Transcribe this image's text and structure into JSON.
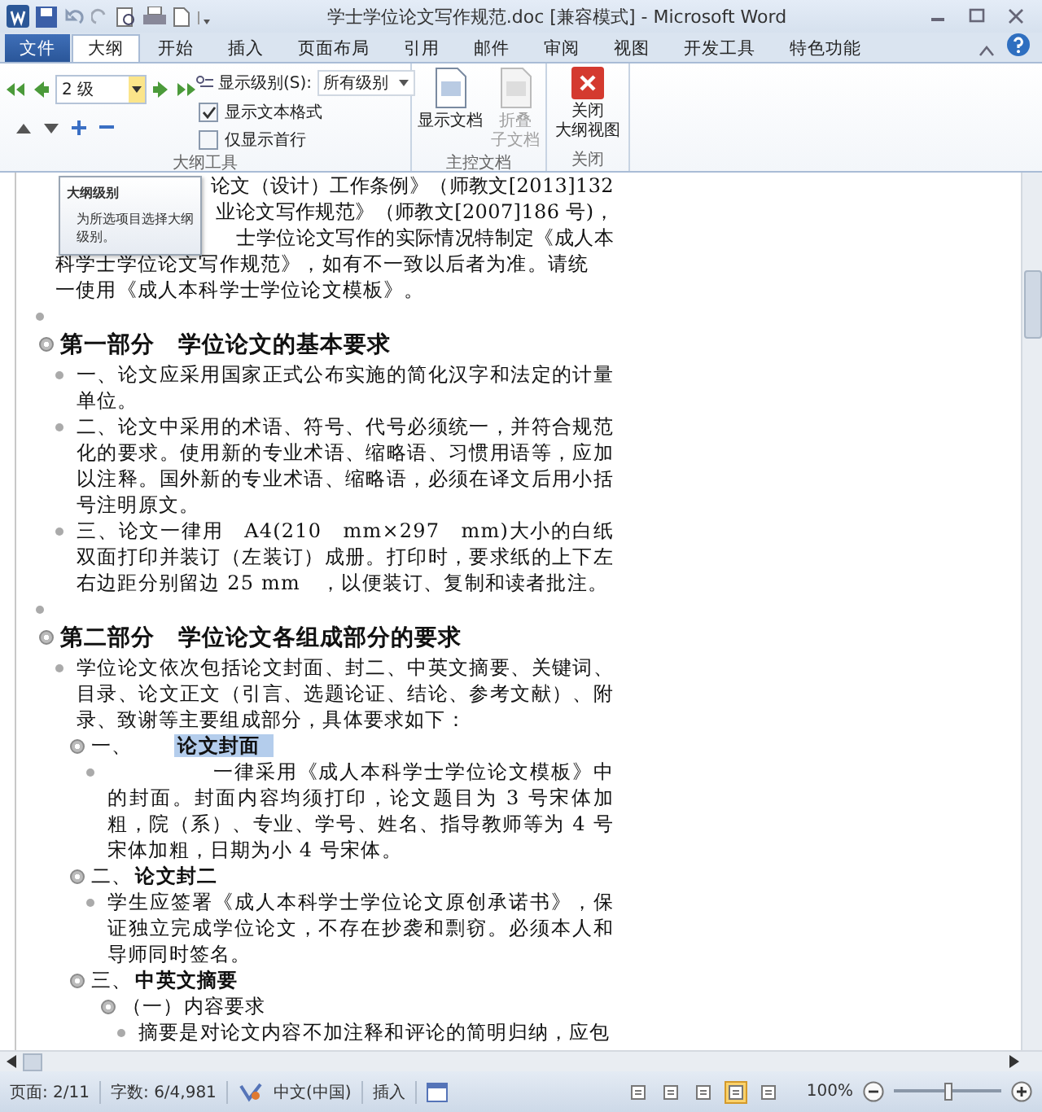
{
  "window": {
    "title": "学士学位论文写作规范.doc [兼容模式] - Microsoft Word"
  },
  "tabs": [
    {
      "label": "文件",
      "kind": "file",
      "selected": false
    },
    {
      "label": "大纲",
      "kind": "tab",
      "selected": true
    },
    {
      "label": "开始",
      "kind": "tab",
      "selected": false
    },
    {
      "label": "插入",
      "kind": "tab",
      "selected": false
    },
    {
      "label": "页面布局",
      "kind": "tab",
      "selected": false
    },
    {
      "label": "引用",
      "kind": "tab",
      "selected": false
    },
    {
      "label": "邮件",
      "kind": "tab",
      "selected": false
    },
    {
      "label": "审阅",
      "kind": "tab",
      "selected": false
    },
    {
      "label": "视图",
      "kind": "tab",
      "selected": false
    },
    {
      "label": "开发工具",
      "kind": "tab",
      "selected": false
    },
    {
      "label": "特色功能",
      "kind": "tab",
      "selected": false
    }
  ],
  "ribbon": {
    "level_select": "2 级",
    "show_level_label": "显示级别(S):",
    "show_level_value": "所有级别",
    "checkboxes": [
      {
        "label": "显示文本格式",
        "checked": true
      },
      {
        "label": "仅显示首行",
        "checked": false
      }
    ],
    "outline_group": "大纲工具",
    "master_buttons": [
      {
        "lines": [
          "显示文档"
        ],
        "disabled": false
      },
      {
        "lines": [
          "折叠",
          "子文档"
        ],
        "disabled": true
      }
    ],
    "master_group": "主控文档",
    "close_button": [
      "关闭",
      "大纲视图"
    ],
    "close_group": "关闭"
  },
  "tooltip": {
    "title": "大纲级别",
    "text": "为所选项目选择大纲级别。"
  },
  "document": {
    "items": [
      {
        "kind": "continued",
        "lines": [
          {
            "text": "论文（设计）工作条例》（师教文[2013]132",
            "partial": true
          },
          {
            "text": "业论文写作规范》（师教文[2007]186 号)，",
            "partial": true
          },
          {
            "text": "士学位论文写作的实际情况特制定《成人本",
            "partial": true
          },
          {
            "text": "科学士学位论文写作规范》，如有不一致以后者为准。请统",
            "partial": false
          },
          {
            "text": "一使用《成人本科学士学位论文模板》。",
            "partial": false
          }
        ]
      },
      {
        "kind": "empty"
      },
      {
        "kind": "h1",
        "text": "第一部分　学位论文的基本要求",
        "children": [
          {
            "kind": "body",
            "text": "一、论文应采用国家正式公布实施的简化汉字和法定的计量单位。"
          },
          {
            "kind": "body",
            "text": "二、论文中采用的术语、符号、代号必须统一，并符合规范化的要求。使用新的专业术语、缩略语、习惯用语等，应加以注释。国外新的专业术语、缩略语，必须在译文后用小括号注明原文。"
          },
          {
            "kind": "body",
            "text": "三、论文一律用　A4(210　mm×297　mm)大小的白纸双面打印并装订（左装订）成册。打印时，要求纸的上下左右边距分别留边 25 mm　，以便装订、复制和读者批注。"
          }
        ]
      },
      {
        "kind": "empty"
      },
      {
        "kind": "h1",
        "text": "第二部分　学位论文各组成部分的要求",
        "children": [
          {
            "kind": "body",
            "text": "学位论文依次包括论文封面、封二、中英文摘要、关键词、目录、论文正文（引言、选题论证、结论、参考文献）、附录、致谢等主要组成部分，具体要求如下："
          },
          {
            "kind": "h2",
            "label": "一、",
            "title": "论文封面",
            "selected": true,
            "children": [
              {
                "kind": "body",
                "text": "　　　　　一律采用《成人本科学士学位论文模板》中的封面。封面内容均须打印，论文题目为 3 号宋体加粗，院（系）、专业、学号、姓名、指导教师等为 4 号宋体加粗，日期为小 4 号宋体。"
              }
            ]
          },
          {
            "kind": "h2",
            "label": "二、",
            "title": "论文封二",
            "selected": false,
            "children": [
              {
                "kind": "body",
                "text": "学生应签署《成人本科学士学位论文原创承诺书》，保证独立完成学位论文，不存在抄袭和剽窃。必须本人和导师同时签名。"
              }
            ]
          },
          {
            "kind": "h2",
            "label": "三、",
            "title": "中英文摘要",
            "selected": false,
            "children": [
              {
                "kind": "h3",
                "text": "（一）内容要求",
                "children": [
                  {
                    "kind": "body",
                    "text": "摘要是对论文内容不加注释和评论的简明归纳，应包"
                  }
                ]
              }
            ]
          }
        ]
      }
    ]
  },
  "status_bar": {
    "page": "页面: 2/11",
    "words": "字数: 6/4,981",
    "language": "中文(中国)",
    "mode": "插入",
    "views": [
      {
        "selected": false
      },
      {
        "selected": false
      },
      {
        "selected": false
      },
      {
        "selected": true
      },
      {
        "selected": false
      }
    ],
    "zoom": "100%",
    "zoom_slider": {
      "level": 0.5
    }
  }
}
